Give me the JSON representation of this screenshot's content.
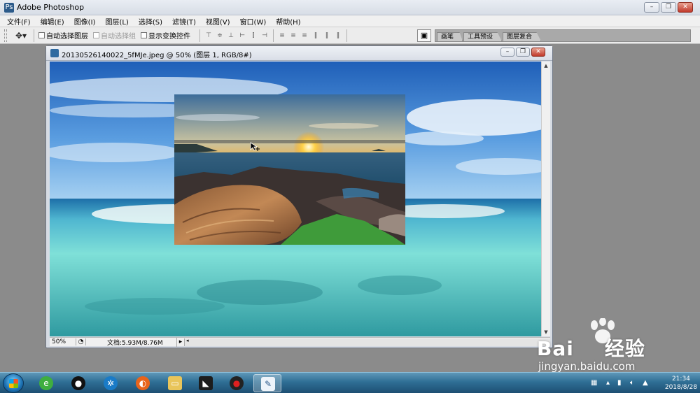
{
  "app": {
    "title": "Adobe Photoshop"
  },
  "menu": [
    "文件(F)",
    "编辑(E)",
    "图像(I)",
    "图层(L)",
    "选择(S)",
    "滤镜(T)",
    "视图(V)",
    "窗口(W)",
    "帮助(H)"
  ],
  "options": {
    "auto_select_layer": "自动选择图层",
    "auto_select_group": "自动选择组",
    "show_transform": "显示变换控件"
  },
  "palette_tabs": [
    "画笔",
    "工具预设",
    "图层复合"
  ],
  "document": {
    "title": "20130526140022_5fMJe.jpeg @ 50% (图层 1, RGB/8#)",
    "zoom": "50%",
    "doc_info": "文档:5.93M/8.76M"
  },
  "taskbar": {
    "time": "21:34",
    "date": "2018/8/28"
  },
  "watermark": {
    "brand": "Bai",
    "brand_cn": "经验",
    "url": "jingyan.baidu.com"
  },
  "colors": {
    "taskbar": "#2f6f95",
    "workspace": "#8b8b8b",
    "accent": "#2b5a8a"
  }
}
